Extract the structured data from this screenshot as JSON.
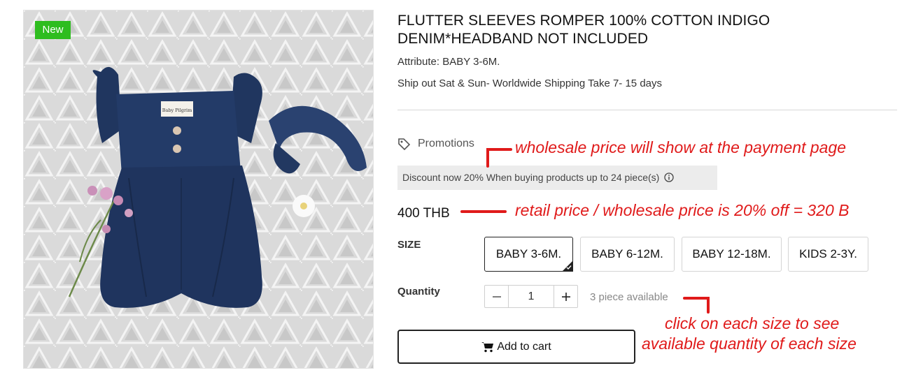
{
  "product": {
    "badge": "New",
    "title": "FLUTTER SLEEVES ROMPER 100% COTTON INDIGO DENIM*HEADBAND NOT INCLUDED",
    "attribute": "Attribute: BABY 3-6M.",
    "shipping": "Ship out Sat & Sun- Worldwide Shipping Take 7- 15 days",
    "garment_label": "Baby Pilgrim"
  },
  "promotions": {
    "label": "Promotions",
    "discount_text": "Discount now 20% When buying products up to 24 piece(s)"
  },
  "price": "400 THB",
  "size": {
    "label": "SIZE",
    "options": [
      "BABY 3-6M.",
      "BABY 6-12M.",
      "BABY 12-18M.",
      "KIDS 2-3Y."
    ],
    "selected": "BABY 3-6M."
  },
  "quantity": {
    "label": "Quantity",
    "value": "1",
    "decrement": "−",
    "increment": "+",
    "available": "3 piece available"
  },
  "cart": {
    "label": "Add to cart"
  },
  "annotations": {
    "wholesale": "wholesale price will show at the payment page",
    "retail": "retail price / wholesale price is  20% off = 320 B",
    "size_hint_1": "click on each size to see",
    "size_hint_2": "available quantity of each size"
  },
  "icons": {
    "promo": "tag-icon",
    "info": "info-icon",
    "cart": "cart-icon",
    "minus": "minus-icon",
    "plus": "plus-icon",
    "check": "checkmark-icon"
  },
  "colors": {
    "badge": "#2ebd1f",
    "annotation": "#e01a1a",
    "denim": "#1f3560",
    "discount_bg": "#ececec"
  }
}
